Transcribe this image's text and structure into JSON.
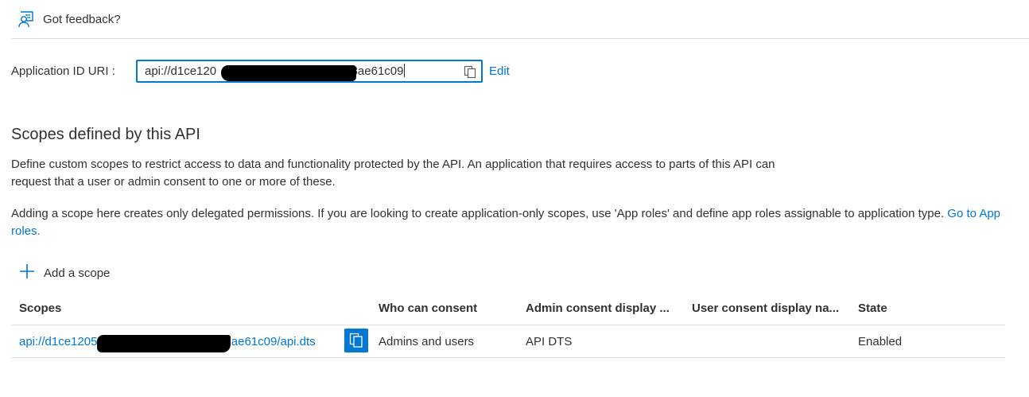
{
  "feedback": {
    "label": "Got feedback?",
    "icon": "feedback-icon"
  },
  "app_id_uri": {
    "label": "Application ID URI :",
    "value_prefix": "api://d1ce120",
    "value_suffix": "c3ae61c09",
    "copy_icon": "copy-icon",
    "edit_label": "Edit"
  },
  "section": {
    "title": "Scopes defined by this API",
    "description_1": "Define custom scopes to restrict access to data and functionality protected by the API. An application that requires access to parts of this API can request that a user or admin consent to one or more of these.",
    "description_2_text": "Adding a scope here creates only delegated permissions. If you are looking to create application-only scopes, use 'App roles' and define app roles assignable to application type.",
    "description_2_link": "Go to App roles."
  },
  "add_scope": {
    "label": "Add a scope",
    "icon": "plus-icon"
  },
  "table": {
    "columns": [
      "Scopes",
      "Who can consent",
      "Admin consent display ...",
      "User consent display na...",
      "State"
    ],
    "rows": [
      {
        "scope_prefix": "api://d1ce1205",
        "scope_suffix": "2ae61c09/api.dts",
        "who_can_consent": "Admins and users",
        "admin_consent_display": "API DTS",
        "user_consent_display": "",
        "state": "Enabled"
      }
    ]
  },
  "colors": {
    "accent": "#0078d4",
    "text": "#323130",
    "divider": "#e1dfdd"
  }
}
